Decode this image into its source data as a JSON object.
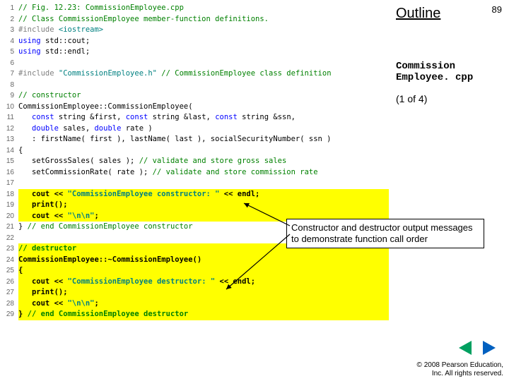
{
  "page_number": "89",
  "outline_label": "Outline",
  "file_label_l1": "Commission",
  "file_label_l2": "Employee. cpp",
  "part_label": "(1 of 4)",
  "callout_text": "Constructor and destructor output messages to demonstrate function call order",
  "copyright_l1": "© 2008 Pearson Education,",
  "copyright_l2": "Inc. All rights reserved.",
  "nav_prev_name": "prev",
  "nav_next_name": "next",
  "code": [
    {
      "n": "1",
      "hl": false,
      "segs": [
        {
          "t": "// Fig. 12.23: CommissionEmployee.cpp",
          "cls": "c-comment"
        }
      ]
    },
    {
      "n": "2",
      "hl": false,
      "segs": [
        {
          "t": "// Class CommissionEmployee member-function definitions.",
          "cls": "c-comment"
        }
      ]
    },
    {
      "n": "3",
      "hl": false,
      "segs": [
        {
          "t": "#include ",
          "cls": "c-pp"
        },
        {
          "t": "<iostream>",
          "cls": "c-str"
        }
      ]
    },
    {
      "n": "4",
      "hl": false,
      "segs": [
        {
          "t": "using ",
          "cls": "c-kw"
        },
        {
          "t": "std::cout;",
          "cls": "c-plain"
        }
      ]
    },
    {
      "n": "5",
      "hl": false,
      "segs": [
        {
          "t": "using ",
          "cls": "c-kw"
        },
        {
          "t": "std::endl;",
          "cls": "c-plain"
        }
      ]
    },
    {
      "n": "6",
      "hl": false,
      "segs": [
        {
          "t": " ",
          "cls": "c-plain"
        }
      ]
    },
    {
      "n": "7",
      "hl": false,
      "segs": [
        {
          "t": "#include ",
          "cls": "c-pp"
        },
        {
          "t": "\"CommissionEmployee.h\"",
          "cls": "c-str"
        },
        {
          "t": " // CommissionEmployee class definition",
          "cls": "c-comment"
        }
      ]
    },
    {
      "n": "8",
      "hl": false,
      "segs": [
        {
          "t": " ",
          "cls": "c-plain"
        }
      ]
    },
    {
      "n": "9",
      "hl": false,
      "segs": [
        {
          "t": "// constructor",
          "cls": "c-comment"
        }
      ]
    },
    {
      "n": "10",
      "hl": false,
      "segs": [
        {
          "t": "CommissionEmployee::CommissionEmployee( ",
          "cls": "c-plain"
        }
      ]
    },
    {
      "n": "11",
      "hl": false,
      "segs": [
        {
          "t": "   const ",
          "cls": "c-kw"
        },
        {
          "t": "string &first, ",
          "cls": "c-plain"
        },
        {
          "t": "const ",
          "cls": "c-kw"
        },
        {
          "t": "string &last, ",
          "cls": "c-plain"
        },
        {
          "t": "const ",
          "cls": "c-kw"
        },
        {
          "t": "string &ssn, ",
          "cls": "c-plain"
        }
      ]
    },
    {
      "n": "12",
      "hl": false,
      "segs": [
        {
          "t": "   double ",
          "cls": "c-kw"
        },
        {
          "t": "sales, ",
          "cls": "c-plain"
        },
        {
          "t": "double ",
          "cls": "c-kw"
        },
        {
          "t": "rate )",
          "cls": "c-plain"
        }
      ]
    },
    {
      "n": "13",
      "hl": false,
      "segs": [
        {
          "t": "   : firstName( first ), lastName( last ), socialSecurityNumber( ssn ) ",
          "cls": "c-plain"
        }
      ]
    },
    {
      "n": "14",
      "hl": false,
      "segs": [
        {
          "t": "{",
          "cls": "c-plain"
        }
      ]
    },
    {
      "n": "15",
      "hl": false,
      "segs": [
        {
          "t": "   setGrossSales( sales ); ",
          "cls": "c-plain"
        },
        {
          "t": "// validate and store gross sales",
          "cls": "c-comment"
        }
      ]
    },
    {
      "n": "16",
      "hl": false,
      "segs": [
        {
          "t": "   setCommissionRate( rate ); ",
          "cls": "c-plain"
        },
        {
          "t": "// validate and store commission rate",
          "cls": "c-comment"
        }
      ]
    },
    {
      "n": "17",
      "hl": false,
      "segs": [
        {
          "t": " ",
          "cls": "c-plain"
        }
      ]
    },
    {
      "n": "18",
      "hl": true,
      "segs": [
        {
          "t": "   cout << ",
          "cls": "c-plain c-bold"
        },
        {
          "t": "\"CommissionEmployee constructor: \"",
          "cls": "c-str c-bold"
        },
        {
          "t": " << endl;",
          "cls": "c-plain c-bold"
        }
      ]
    },
    {
      "n": "19",
      "hl": true,
      "segs": [
        {
          "t": "   print();",
          "cls": "c-plain c-bold"
        }
      ]
    },
    {
      "n": "20",
      "hl": true,
      "segs": [
        {
          "t": "   cout << ",
          "cls": "c-plain c-bold"
        },
        {
          "t": "\"\\n\\n\"",
          "cls": "c-str c-bold"
        },
        {
          "t": ";",
          "cls": "c-plain c-bold"
        }
      ]
    },
    {
      "n": "21",
      "hl": false,
      "segs": [
        {
          "t": "} ",
          "cls": "c-plain"
        },
        {
          "t": "// end CommissionEmployee constructor",
          "cls": "c-comment"
        }
      ]
    },
    {
      "n": "22",
      "hl": false,
      "segs": [
        {
          "t": " ",
          "cls": "c-plain"
        }
      ]
    },
    {
      "n": "23",
      "hl": true,
      "segs": [
        {
          "t": "// destructor",
          "cls": "c-comment c-bold"
        }
      ]
    },
    {
      "n": "24",
      "hl": true,
      "segs": [
        {
          "t": "CommissionEmployee::~CommissionEmployee()",
          "cls": "c-plain c-bold"
        }
      ]
    },
    {
      "n": "25",
      "hl": true,
      "segs": [
        {
          "t": "{",
          "cls": "c-plain c-bold"
        }
      ]
    },
    {
      "n": "26",
      "hl": true,
      "segs": [
        {
          "t": "   cout << ",
          "cls": "c-plain c-bold"
        },
        {
          "t": "\"CommissionEmployee destructor: \"",
          "cls": "c-str c-bold"
        },
        {
          "t": " << endl;",
          "cls": "c-plain c-bold"
        }
      ]
    },
    {
      "n": "27",
      "hl": true,
      "segs": [
        {
          "t": "   print();",
          "cls": "c-plain c-bold"
        }
      ]
    },
    {
      "n": "28",
      "hl": true,
      "segs": [
        {
          "t": "   cout << ",
          "cls": "c-plain c-bold"
        },
        {
          "t": "\"\\n\\n\"",
          "cls": "c-str c-bold"
        },
        {
          "t": ";",
          "cls": "c-plain c-bold"
        }
      ]
    },
    {
      "n": "29",
      "hl": true,
      "segs": [
        {
          "t": "} ",
          "cls": "c-plain c-bold"
        },
        {
          "t": "// end CommissionEmployee destructor",
          "cls": "c-comment c-bold"
        }
      ]
    }
  ]
}
